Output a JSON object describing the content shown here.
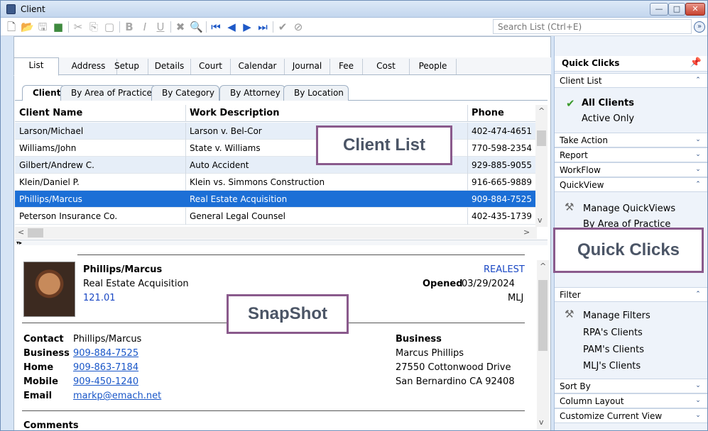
{
  "window": {
    "title": "Client"
  },
  "toolbar": {
    "search_placeholder": "Search List (Ctrl+E)"
  },
  "main_tabs": [
    "List",
    "Address",
    "Setup",
    "Details",
    "Court",
    "Calendar",
    "Journal",
    "Fee",
    "Cost",
    "People"
  ],
  "sub_tabs": [
    "Client",
    "By Area of Practice",
    "By Category",
    "By Attorney",
    "By Location"
  ],
  "grid": {
    "headers": [
      "Client Name",
      "Work Description",
      "Phone"
    ],
    "rows": [
      {
        "name": "Larson/Michael",
        "work": "Larson v. Bel-Cor",
        "phone": "402-474-4651"
      },
      {
        "name": "Williams/John",
        "work": "State v. Williams",
        "phone": "770-598-2354"
      },
      {
        "name": "Gilbert/Andrew C.",
        "work": "Auto Accident",
        "phone": "929-885-9055"
      },
      {
        "name": "Klein/Daniel P.",
        "work": "Klein vs. Simmons Construction",
        "phone": "916-665-9889"
      },
      {
        "name": "Phillips/Marcus",
        "work": "Real Estate Acquisition",
        "phone": "909-884-7525"
      },
      {
        "name": "Peterson Insurance Co.",
        "work": "General Legal Counsel",
        "phone": "402-435-1739"
      }
    ]
  },
  "snapshot": {
    "name": "Phillips/Marcus",
    "work": "Real Estate Acquisition",
    "number": "121.01",
    "area_code": "REALEST",
    "opened_label": "Opened",
    "opened_date": "03/29/2024",
    "attorney": "MLJ",
    "contact_label": "Contact",
    "contact_value": "Phillips/Marcus",
    "business_label": "Business",
    "business_phone": "909-884-7525",
    "home_label": "Home",
    "home_phone": "909-863-7184",
    "mobile_label": "Mobile",
    "mobile_phone": "909-450-1240",
    "email_label": "Email",
    "email_value": "markp@emach.net",
    "address_title": "Business",
    "address_line1": "Marcus Phillips",
    "address_line2": "27550 Cottonwood Drive",
    "address_line3": "San Bernardino  CA  92408",
    "comments_label": "Comments"
  },
  "callouts": {
    "client_list": "Client List",
    "snapshot": "SnapShot",
    "quick_clicks": "Quick Clicks"
  },
  "quick_clicks": {
    "title": "Quick Clicks",
    "sections": {
      "client_list": "Client List",
      "take_action": "Take Action",
      "report": "Report",
      "workflow": "WorkFlow",
      "quickview": "QuickView",
      "filter": "Filter",
      "sort_by": "Sort By",
      "column_layout": "Column Layout",
      "customize": "Customize Current View"
    },
    "client_list_items": {
      "all": "All Clients",
      "active": "Active Only"
    },
    "quickview_items": {
      "manage": "Manage QuickViews",
      "by_area": "By Area of Practice"
    },
    "filter_items": {
      "manage": "Manage Filters",
      "rpa": "RPA's Clients",
      "pam": "PAM's Clients",
      "mlj": "MLJ's Clients"
    }
  }
}
